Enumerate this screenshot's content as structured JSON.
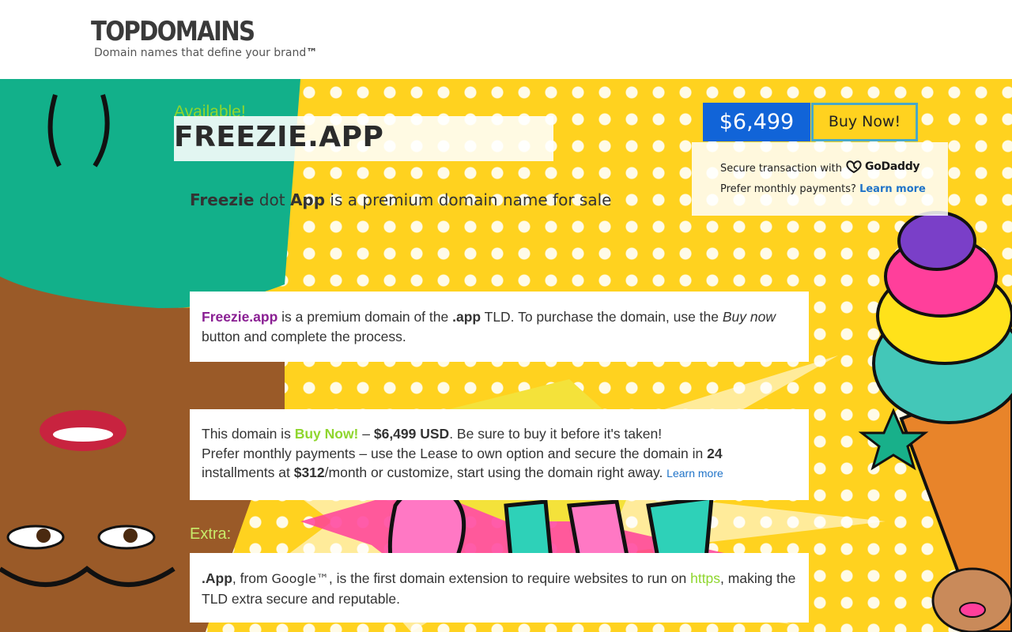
{
  "header": {
    "logo": "TOPDOMAINS",
    "tagline_text": "Domain names that define your brand",
    "tagline_mark": "™"
  },
  "hero": {
    "available": "Available!",
    "domain": "FREEZIE.APP",
    "subtitle": {
      "word1": "Freezie",
      "dot": " dot ",
      "word2": "App",
      "rest": " is a premium domain name for sale"
    }
  },
  "purchase": {
    "price": "$6,499",
    "buy_label": "Buy Now!",
    "secure_text": "Secure transaction with",
    "provider": "GoDaddy",
    "monthly_question": "Prefer monthly payments?",
    "learn_more": "Learn more"
  },
  "card1": {
    "domain": "Freezie.app",
    "t1": " is a premium domain of the ",
    "tld": ".app",
    "t2": " TLD. To purchase the domain, use the ",
    "buy_now_italic": "Buy now",
    "t3": " button and complete the process."
  },
  "card2": {
    "t1": "This domain is ",
    "buy_now": "Buy Now!",
    "t2": " – ",
    "price_usd": "$6,499 USD",
    "t3": ". Be sure to buy it before it's taken!",
    "t4": "Prefer monthly payments – use the Lease to own option and secure the domain in ",
    "installments": "24",
    "t5": " installments at ",
    "monthly_price": "$312",
    "t6": "/month or customize, start using the domain right away. ",
    "learn_more": "Learn more"
  },
  "extra": {
    "label": "Extra:",
    "tld": ".App",
    "t1": ", from ",
    "google": "Google™",
    "t2": ", is the first domain extension to require websites to run on ",
    "https": "https",
    "t3": ", making the TLD extra secure and reputable."
  },
  "colors": {
    "accent_blue": "#1164d8",
    "accent_green": "#8fd62e",
    "accent_purple": "#8a1f93",
    "hero_yellow": "#ffd21f"
  }
}
